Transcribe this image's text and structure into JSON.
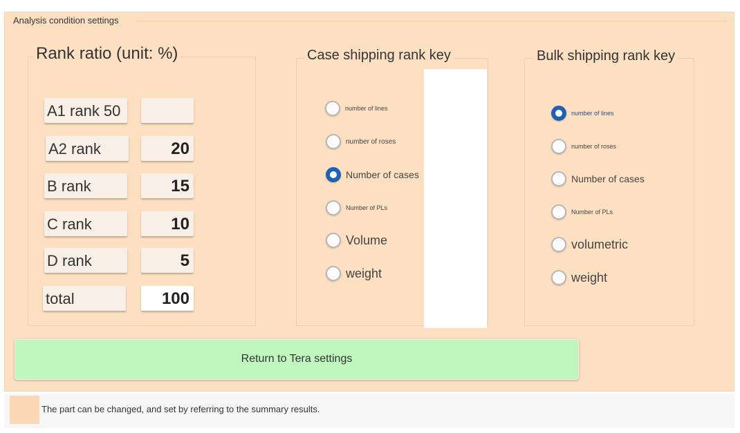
{
  "panel": {
    "title": "Analysis condition settings"
  },
  "rank_ratio": {
    "title": "Rank ratio (unit: %)",
    "rows": [
      {
        "label": "A1 rank 50",
        "value": ""
      },
      {
        "label": "A2 rank",
        "value": "20"
      },
      {
        "label": "B rank",
        "value": "15"
      },
      {
        "label": "C rank",
        "value": "10"
      },
      {
        "label": "D rank",
        "value": "5"
      },
      {
        "label": "total",
        "value": "100"
      }
    ]
  },
  "case_key": {
    "title": "Case shipping rank key",
    "selected": "Number of cases",
    "options": [
      "number of lines",
      "number of roses",
      "Number of cases",
      "Number of PLs",
      "Volume",
      "weight"
    ]
  },
  "bulk_key": {
    "title": "Bulk shipping rank key",
    "selected": "number of lines",
    "options": [
      "number of lines",
      "number of roses",
      "Number of cases",
      "Number of PLs",
      "volumetric",
      "weight"
    ]
  },
  "return_button": {
    "label": "Return to Tera settings"
  },
  "note": {
    "text": "The part can be changed, and set by referring to the summary results.",
    "swatch_color": "#fcd8b6"
  },
  "colors": {
    "panel_bg": "#fde0c2",
    "button_bg": "#bff7bf",
    "radio_accent": "#1f62b5"
  }
}
